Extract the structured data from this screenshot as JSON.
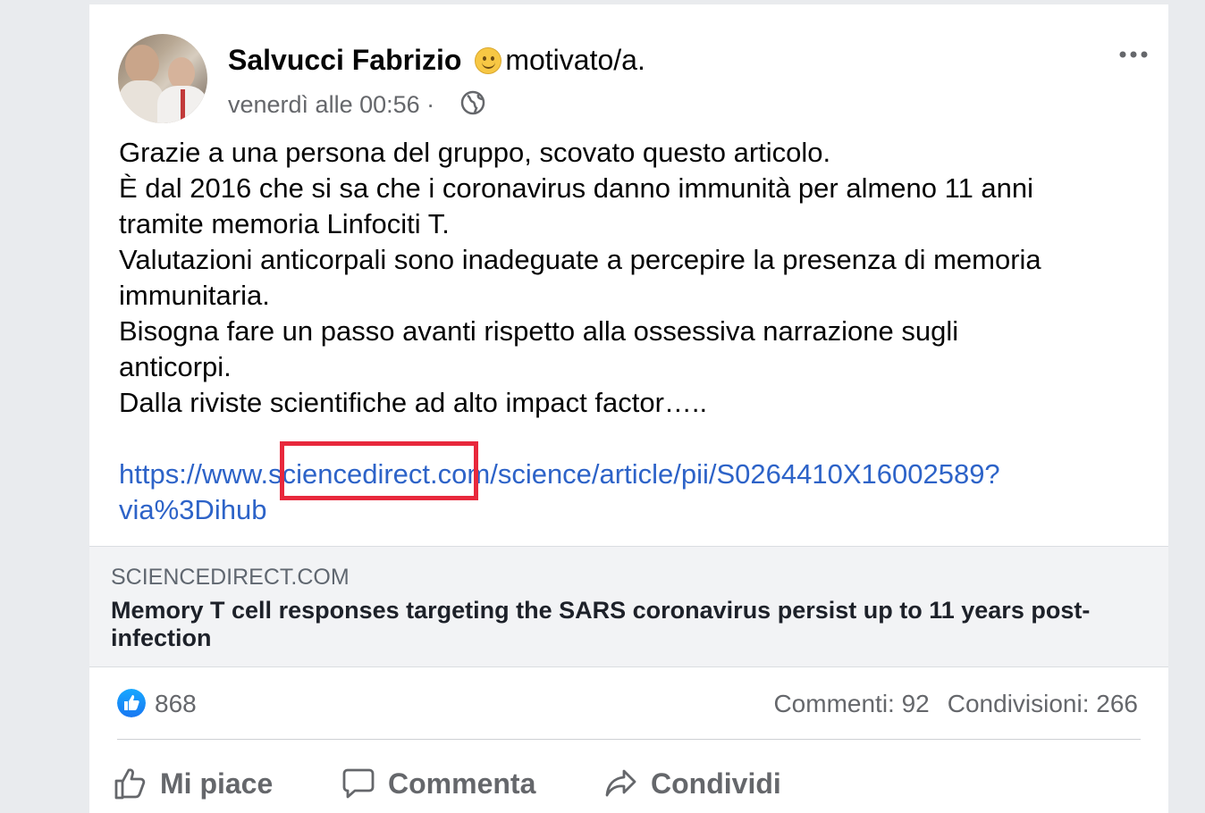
{
  "post": {
    "author": "Salvucci Fabrizio",
    "feeling": "motivato/a.",
    "timestamp": "venerdì alle 00:56 ·",
    "privacy_icon": "globe-icon",
    "body_lines": [
      "Grazie a una persona del gruppo, scovato questo articolo.",
      "È  dal 2016 che si sa che i coronavirus danno immunità per almeno 11 anni",
      "tramite memoria Linfociti  T.",
      "Valutazioni anticorpali sono inadeguate a percepire la presenza  di memoria",
      "immunitaria.",
      "Bisogna  fare un passo avanti rispetto  alla ossessiva narrazione sugli",
      "anticorpi.",
      "Dalla riviste scientifiche  ad alto impact factor….."
    ],
    "link_lines": [
      "https://www.sciencedirect.com/science/article/pii/S0264410X16002589?",
      "via%3Dihub"
    ],
    "highlight_color": "#e8283c",
    "link_color": "#2d63c8"
  },
  "preview": {
    "domain": "SCIENCEDIRECT.COM",
    "title": "Memory T cell responses targeting the SARS coronavirus persist up to 11 years post-infection"
  },
  "stats": {
    "likes": "868",
    "comments": "Commenti: 92",
    "shares": "Condivisioni: 266"
  },
  "actions": {
    "like": "Mi piace",
    "comment": "Commenta",
    "share": "Condividi"
  }
}
